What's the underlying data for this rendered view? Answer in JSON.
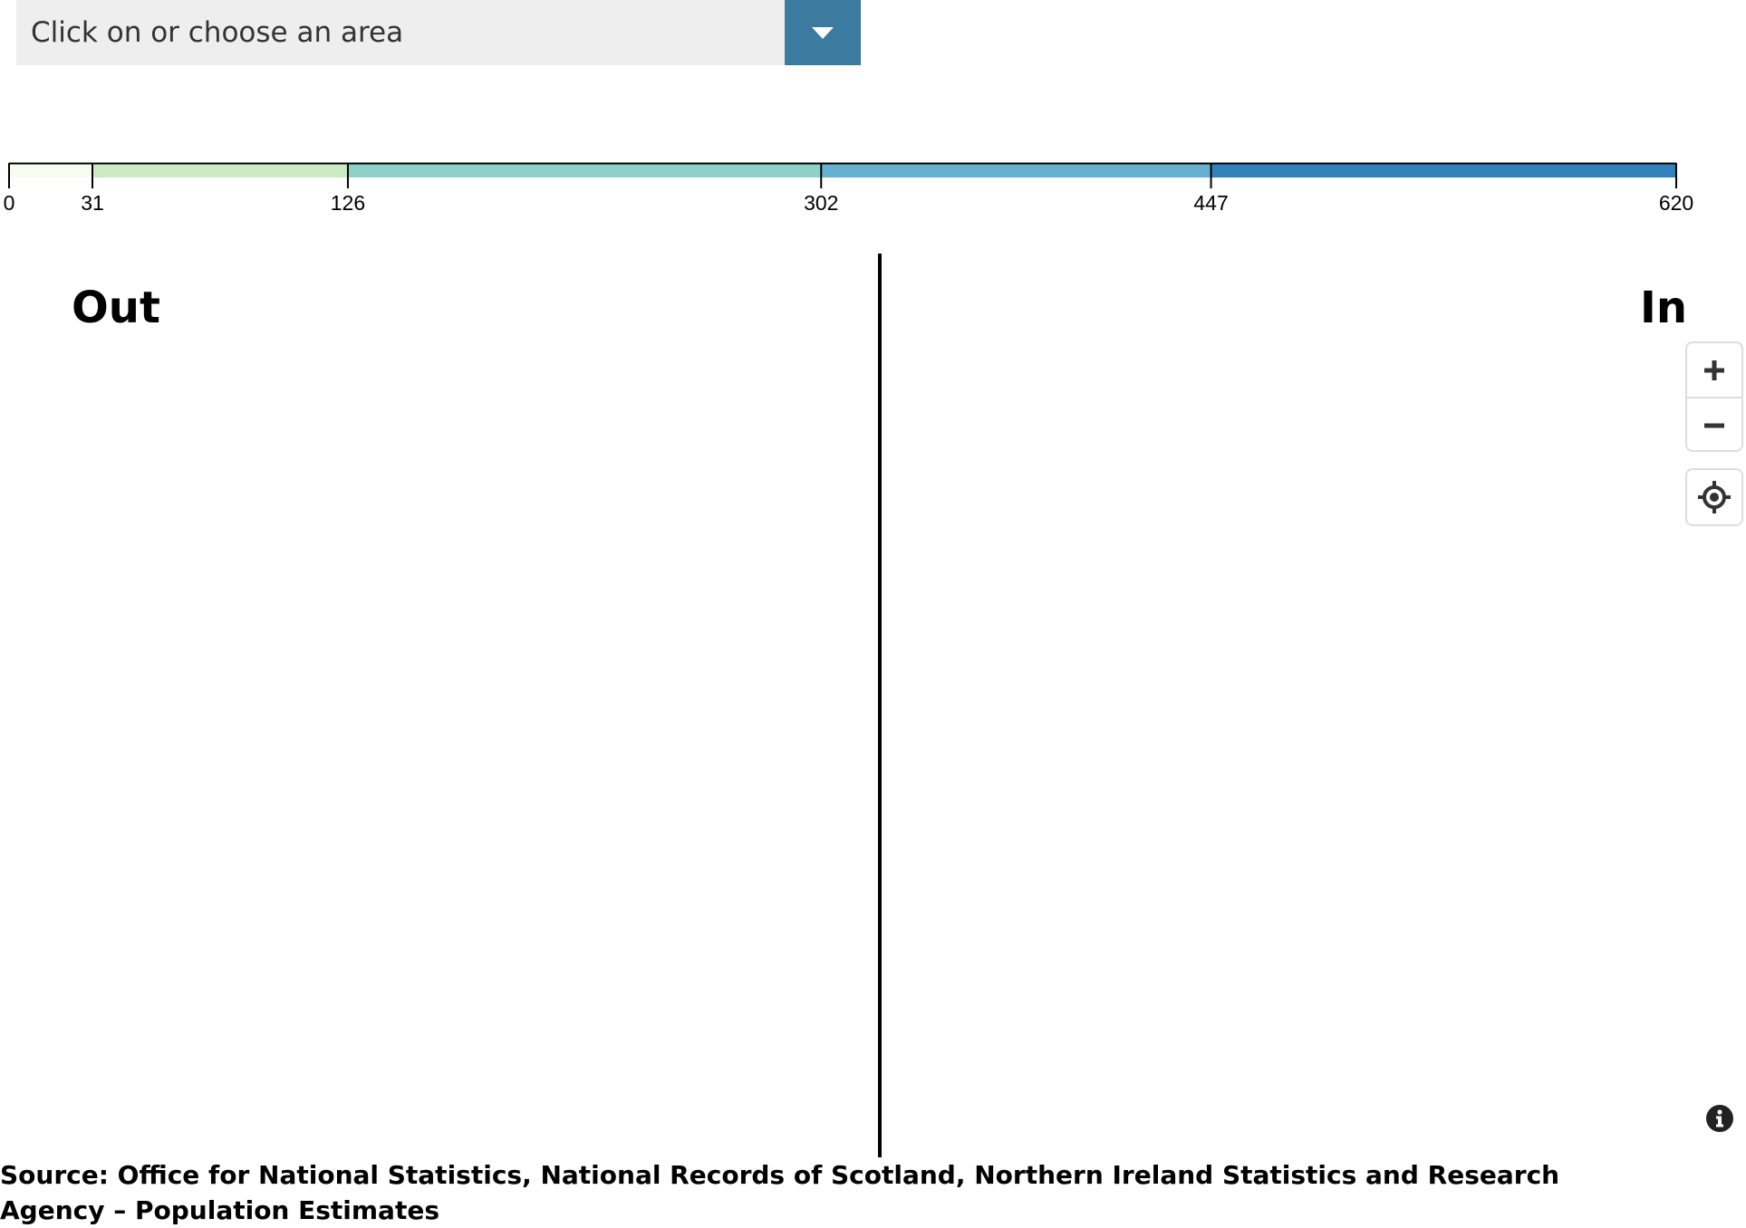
{
  "area_select": {
    "placeholder": "Click on or choose an area",
    "toggle_icon": "caret-down-icon",
    "accent_color": "#3c7aa0"
  },
  "legend": {
    "breaks": [
      "0",
      "31",
      "126",
      "302",
      "447",
      "620"
    ],
    "break_values": [
      0,
      31,
      126,
      302,
      447,
      620
    ],
    "colors": [
      "#f7fcf0",
      "#ccebc5",
      "#8fd0c8",
      "#67b0cf",
      "#3383bb"
    ]
  },
  "panes": {
    "out_title": "Out",
    "in_title": "In"
  },
  "controls": {
    "zoom_in_icon": "plus-icon",
    "zoom_out_icon": "minus-icon",
    "locate_icon": "crosshair-icon",
    "info_icon": "info-icon"
  },
  "source": {
    "text": "Source: Office for National Statistics, National Records of Scotland, Northern Ireland Statistics and Research Agency – Population Estimates"
  }
}
